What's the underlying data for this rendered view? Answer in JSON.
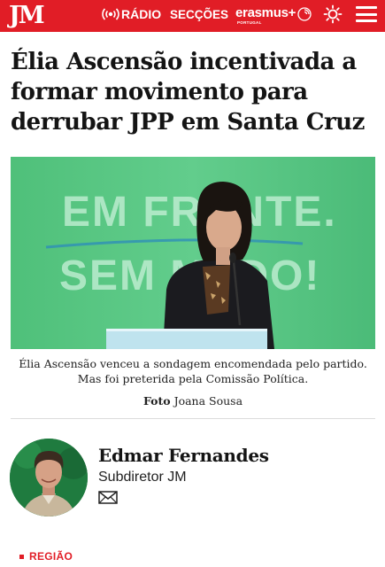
{
  "header": {
    "logo": "JM",
    "radio_label": "RÁDIO",
    "sections_label": "SECÇÕES",
    "partner": {
      "name": "erasmus+",
      "sub": "PORTUGAL"
    },
    "theme_icon": "sun-icon",
    "menu_icon": "hamburger-menu-icon",
    "brand_color": "#e11d26"
  },
  "article": {
    "headline": "Élia Ascensão incentivada a formar movimento para derrubar JPP em Santa Cruz",
    "photo": {
      "banner_line1": "EM FRENTE.",
      "banner_line2": "SEM MEDO!"
    },
    "caption": "Élia Ascensão venceu a sondagem encomendada pelo partido. Mas foi preterida pela Comissão Política.",
    "credit_label": "Foto",
    "credit_name": "Joana Sousa"
  },
  "author": {
    "name": "Edmar Fernandes",
    "role": "Subdiretor JM",
    "contact_icon": "mail-icon"
  },
  "section_tag": "REGIÃO"
}
